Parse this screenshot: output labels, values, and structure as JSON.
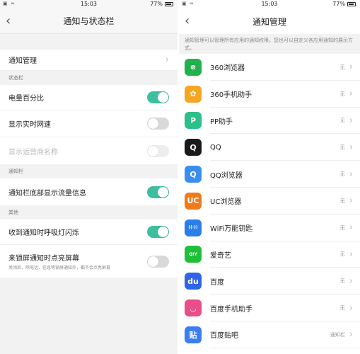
{
  "left": {
    "status": {
      "left_icons": "▣ ≈",
      "time": "15:03",
      "battery": "77%"
    },
    "title": "通知与状态栏",
    "back_icon": "‹",
    "notify_manage_label": "通知管理",
    "section_statusbar": "状态栏",
    "battery_percent_label": "电量百分比",
    "realtime_speed_label": "显示实时网速",
    "carrier_name_label": "显示运营商名称",
    "section_notifybar": "通知栏",
    "traffic_info_label": "通知栏底部显示流量信息",
    "section_other": "其他",
    "breathing_light_label": "收到通知时呼吸灯闪烁",
    "lockscreen_wake_label": "来锁屏通知时点亮屏幕",
    "lockscreen_wake_sub": "关闭后，除电话、信息等锁屏通知外，都不会点亮屏幕",
    "toggles": {
      "battery_percent": true,
      "realtime_speed": false,
      "carrier_name": false,
      "traffic_info": true,
      "breathing_light": true,
      "lockscreen_wake": false
    }
  },
  "right": {
    "status": {
      "left_icons": "▣ ≈",
      "time": "15:03",
      "battery": "77%"
    },
    "title": "通知管理",
    "back_icon": "‹",
    "description": "通知管理可以管理所有应用的通知权限，您也可以自定义各应用通知的展示方式。",
    "apps": [
      {
        "name": "360浏览器",
        "status": "无",
        "icon": "360-browser-icon",
        "color": "#22b14c",
        "glyph": "e"
      },
      {
        "name": "360手机助手",
        "status": "无",
        "icon": "360-assistant-icon",
        "color": "#f5a623",
        "glyph": "✿"
      },
      {
        "name": "PP助手",
        "status": "无",
        "icon": "pp-assistant-icon",
        "color": "#2bbf8a",
        "glyph": "P"
      },
      {
        "name": "QQ",
        "status": "无",
        "icon": "qq-penguin-icon",
        "color": "#1a1a1a",
        "glyph": "Q"
      },
      {
        "name": "QQ浏览器",
        "status": "无",
        "icon": "qq-browser-icon",
        "color": "#3a8ef0",
        "glyph": "Q"
      },
      {
        "name": "UC浏览器",
        "status": "无",
        "icon": "uc-browser-icon",
        "color": "#f07a1a",
        "glyph": "UC"
      },
      {
        "name": "WiFi万能钥匙",
        "status": "无",
        "icon": "wifi-key-icon",
        "color": "#2b7de9",
        "glyph": "((·))"
      },
      {
        "name": "爱奇艺",
        "status": "无",
        "icon": "iqiyi-icon",
        "color": "#1fbf3a",
        "glyph": "QIY"
      },
      {
        "name": "百度",
        "status": "无",
        "icon": "baidu-paw-icon",
        "color": "#2f64e8",
        "glyph": "du"
      },
      {
        "name": "百度手机助手",
        "status": "无",
        "icon": "baidu-assistant-icon",
        "color": "#e94e8a",
        "glyph": "◡"
      },
      {
        "name": "百度贴吧",
        "status": "通知栏",
        "icon": "baidu-tieba-icon",
        "color": "#3a7ef0",
        "glyph": "贴"
      }
    ]
  },
  "colors": {
    "toggle_on": "#3dbe9e",
    "toggle_off": "#d9d9d9"
  }
}
